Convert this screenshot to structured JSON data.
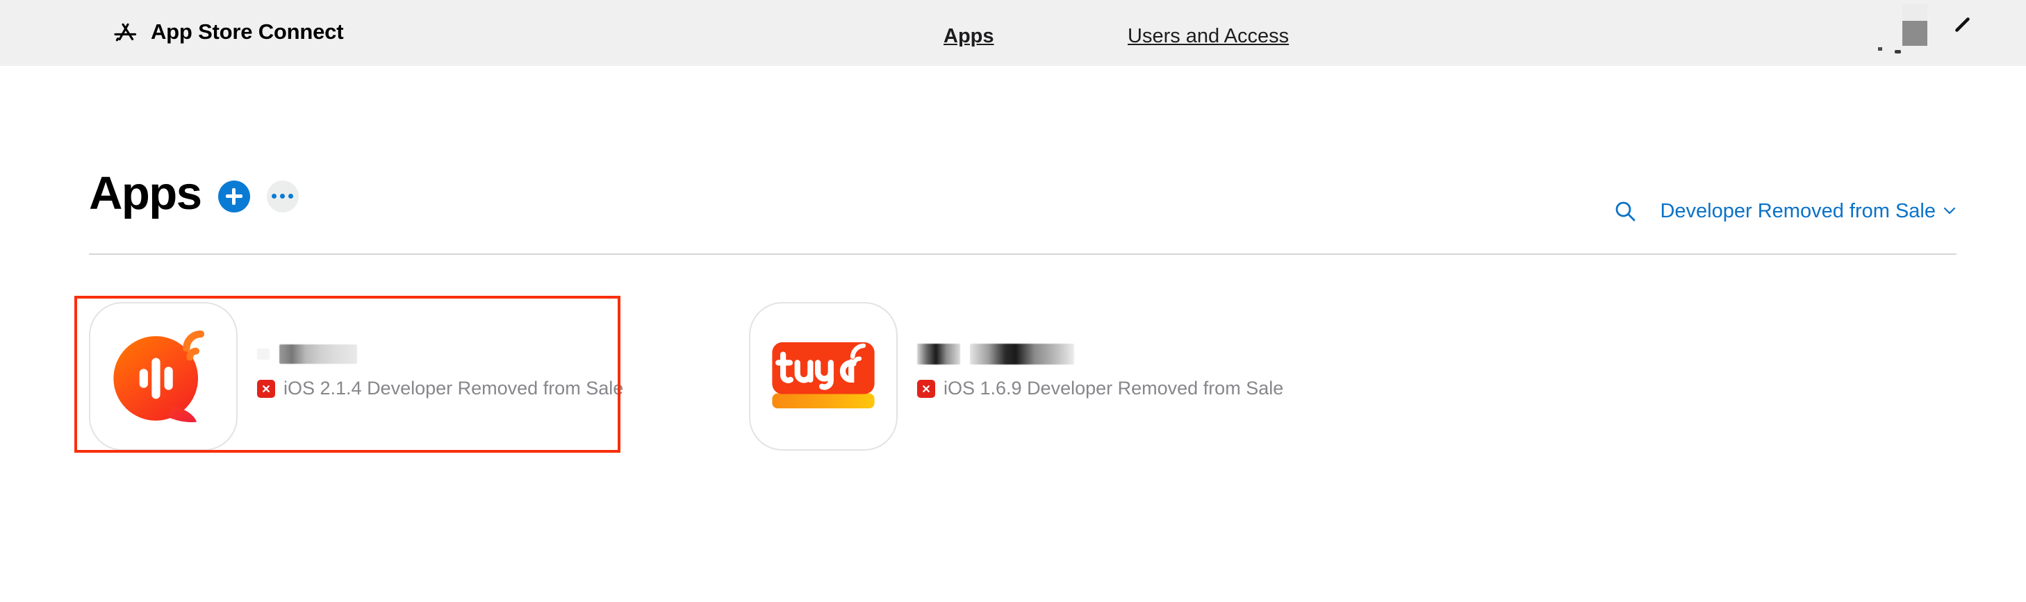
{
  "topbar": {
    "brand_icon": "app-store-icon",
    "brand_title": "App Store Connect",
    "nav": [
      {
        "label": "Apps",
        "active": true
      },
      {
        "label": "Users and Access",
        "active": false
      }
    ],
    "avatar_icon": "avatar-redacted",
    "edit_icon": "pencil-icon"
  },
  "page": {
    "title": "Apps",
    "add_button_icon": "plus-icon",
    "more_button_icon": "ellipsis-icon",
    "search_icon": "search-icon",
    "filter": {
      "label": "Developer Removed from Sale",
      "chevron_icon": "chevron-down-icon",
      "color": "#0a72c8"
    }
  },
  "apps": [
    {
      "icon": "speech-bubble-waveform-icon",
      "name_redacted": true,
      "status_icon": "x-badge-icon",
      "status": "iOS 2.1.4 Developer Removed from Sale",
      "selected": true
    },
    {
      "icon": "tuya-logo-icon",
      "name_redacted": true,
      "status_icon": "x-badge-icon",
      "status": "iOS 1.6.9 Developer Removed from Sale",
      "selected": false
    }
  ],
  "colors": {
    "accent_blue": "#0a7bd4",
    "link_blue": "#0a72c8",
    "status_gray": "#86868b",
    "badge_red": "#e2231a",
    "selection_red": "#f82f0c",
    "topbar_bg": "#f0f0f0"
  }
}
